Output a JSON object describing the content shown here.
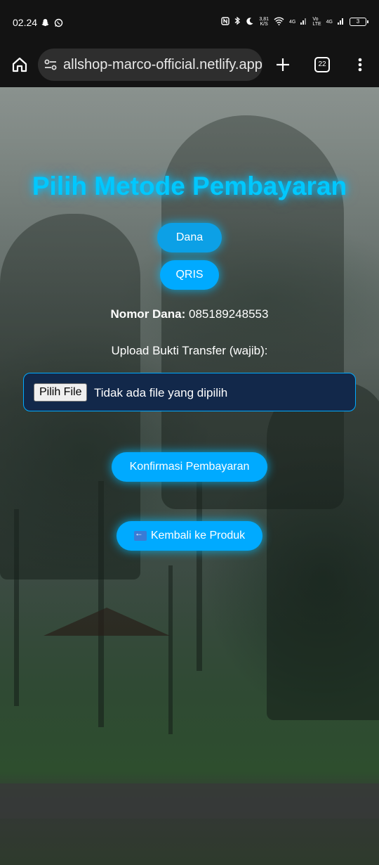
{
  "status_bar": {
    "time": "02.24",
    "net_speed_top": "3,81",
    "net_speed_bottom": "K/S",
    "sim1": "4G",
    "volte_top": "Vo",
    "volte_bottom": "LTE",
    "sim2": "4G",
    "battery_level": "3"
  },
  "browser": {
    "url": "allshop-marco-official.netlify.app",
    "tab_count": "22"
  },
  "page": {
    "title": "Pilih Metode Pembayaran",
    "methods": [
      {
        "label": "Dana"
      },
      {
        "label": "QRIS"
      }
    ],
    "nomor_label": "Nomor Dana:",
    "nomor_value": "085189248553",
    "upload_label": "Upload Bukti Transfer (wajib):",
    "file_button": "Pilih File",
    "file_status": "Tidak ada file yang dipilih",
    "confirm_button": "Konfirmasi Pembayaran",
    "back_button": "Kembali ke Produk",
    "accent_color": "#00aaff"
  }
}
